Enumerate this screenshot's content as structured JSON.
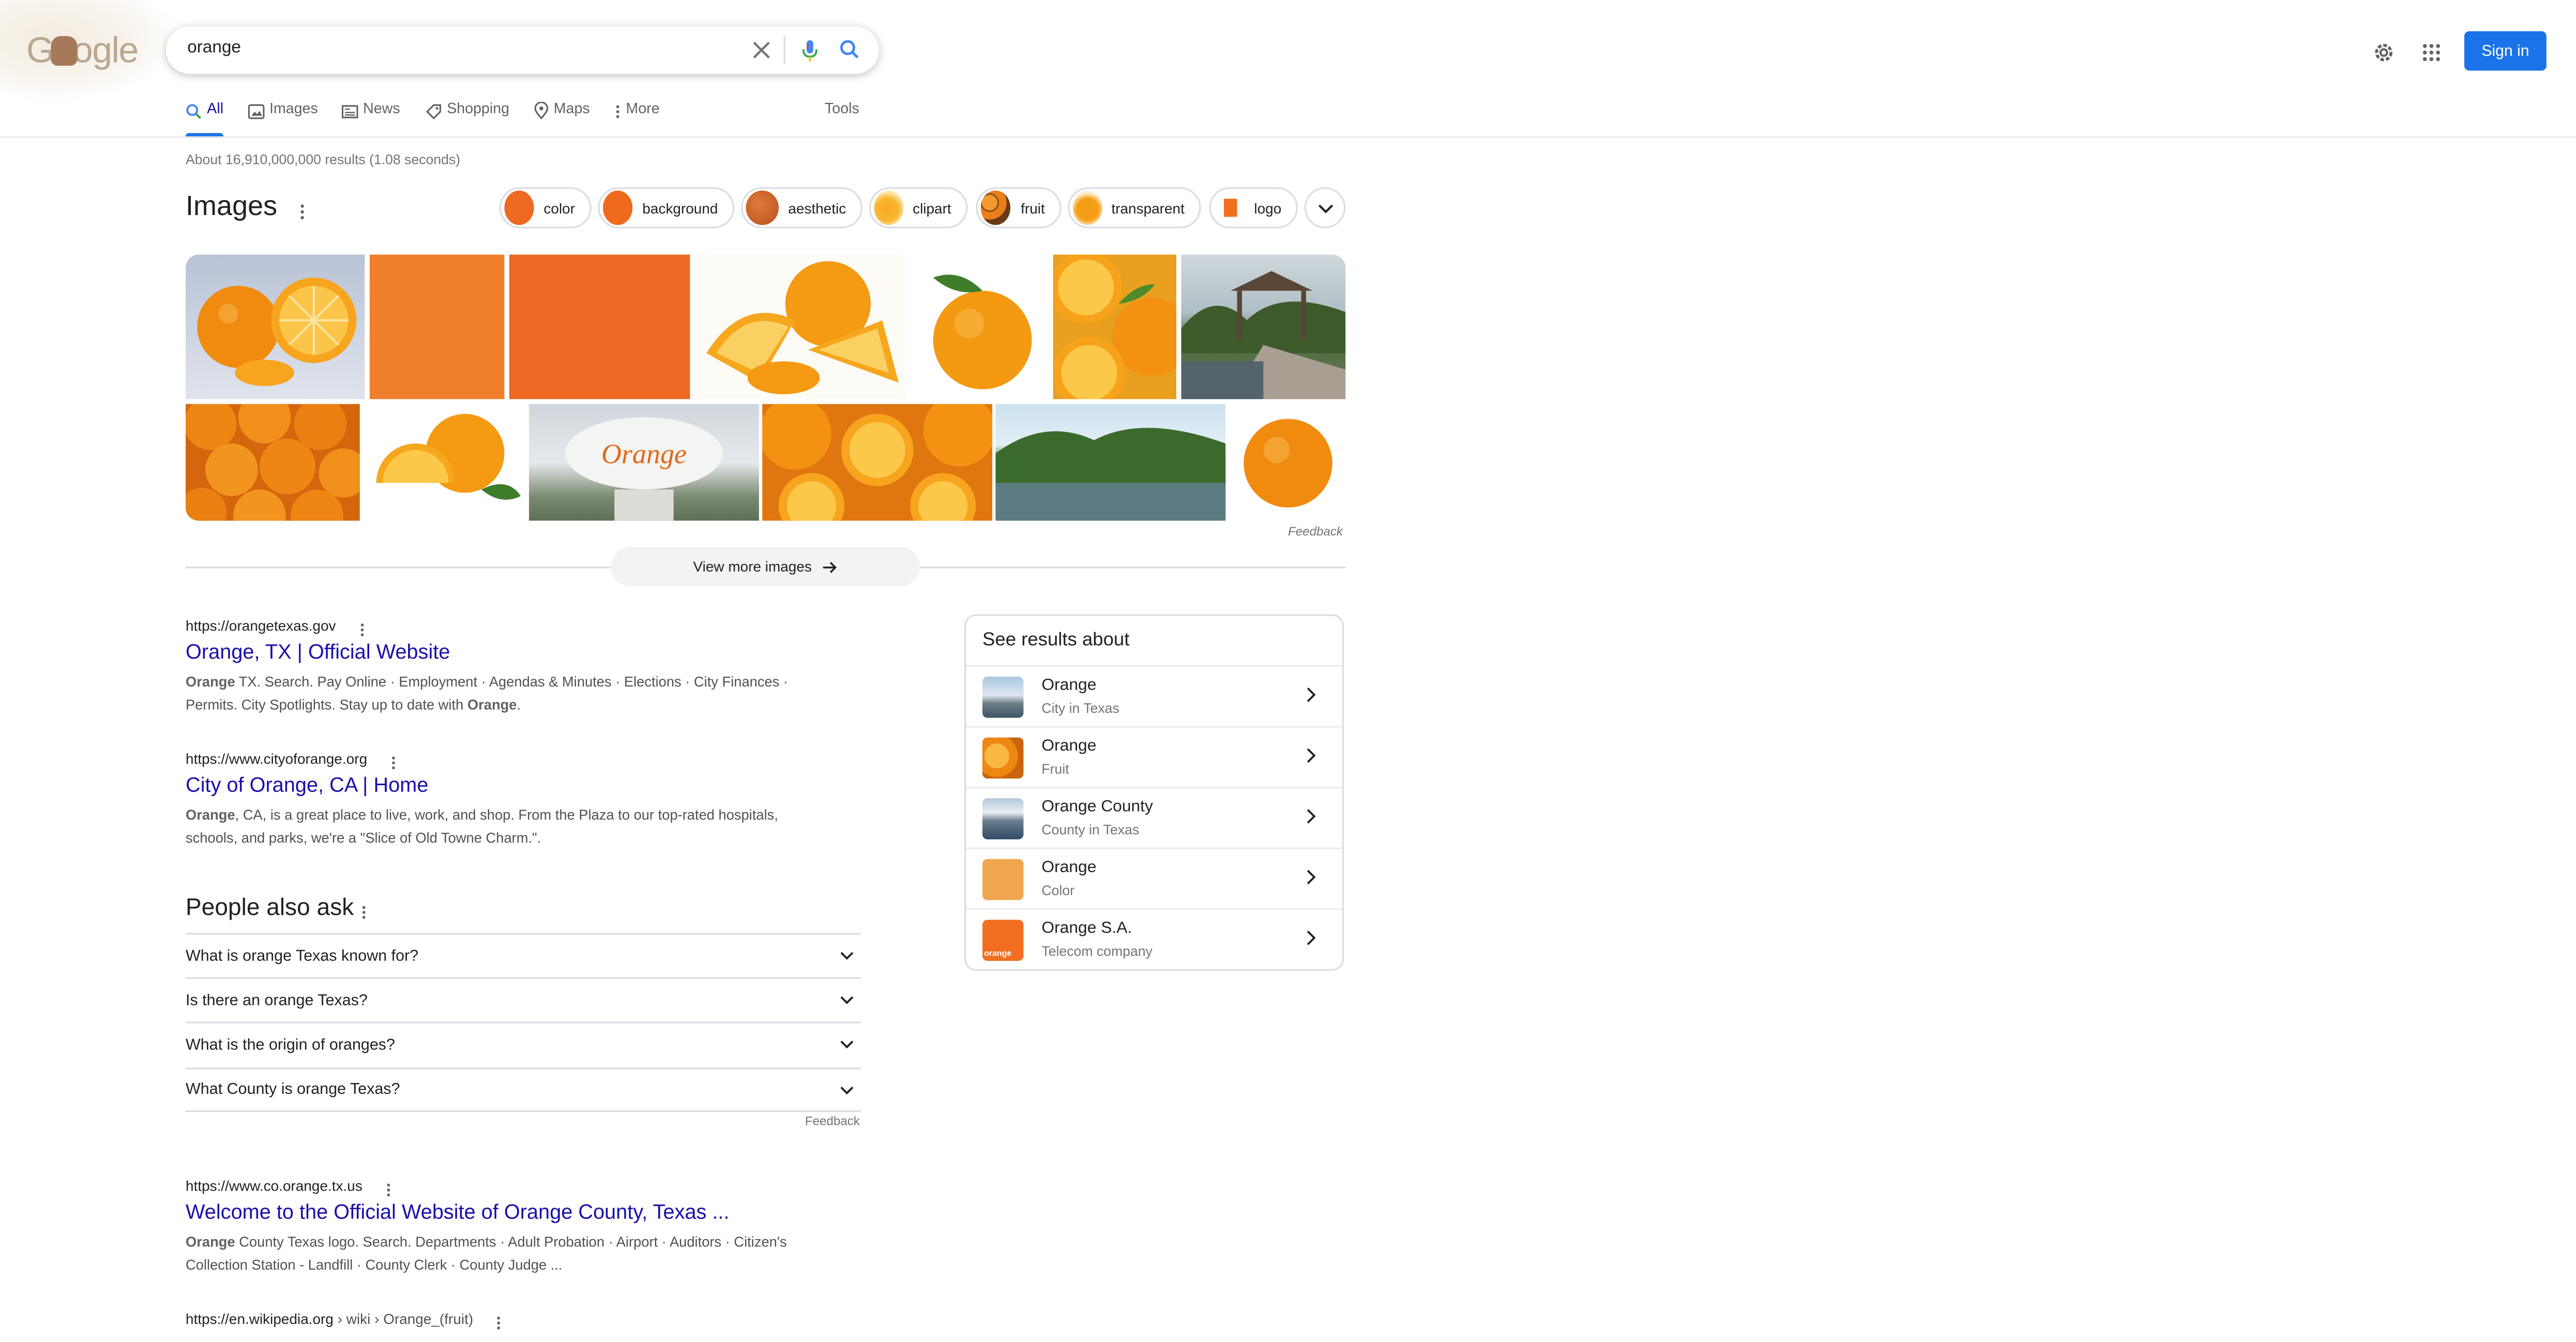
{
  "brand": {
    "logo_text": "Google",
    "accent": "#1a73e8",
    "link_color": "#1a0dab"
  },
  "search": {
    "query": "orange",
    "clear_icon": "close-icon",
    "mic_icon": "mic-icon",
    "search_icon": "search-icon"
  },
  "header": {
    "sign_in_label": "Sign in",
    "settings_icon": "gear-icon",
    "apps_icon": "apps-grid-icon"
  },
  "tabs": [
    {
      "label": "All",
      "icon": "search-icon",
      "active": true
    },
    {
      "label": "Images",
      "icon": "image-icon"
    },
    {
      "label": "News",
      "icon": "news-icon"
    },
    {
      "label": "Shopping",
      "icon": "tag-icon"
    },
    {
      "label": "Maps",
      "icon": "map-pin-icon"
    },
    {
      "label": "More",
      "icon": "more-vert-icon"
    }
  ],
  "tools_label": "Tools",
  "result_stats": "About 16,910,000,000 results (1.08 seconds)",
  "images_section": {
    "title": "Images",
    "chips": [
      "color",
      "background",
      "aesthetic",
      "clipart",
      "fruit",
      "transparent",
      "logo"
    ],
    "feedback": "Feedback",
    "view_more": "View more images"
  },
  "results": [
    {
      "url": "https://orangetexas.gov",
      "title": "Orange, TX | Official Website",
      "snippet_bold": "Orange",
      "snippet_line1": " TX. Search. Pay Online · Employment · Agendas & Minutes · Elections · City Finances ·",
      "snippet_line2": "Permits. City Spotlights. Stay up to date with ",
      "snippet_bold2": "Orange",
      "snippet_end": "."
    },
    {
      "url": "https://www.cityoforange.org",
      "title": "City of Orange, CA | Home",
      "snippet_bold": "Orange",
      "snippet_line1": ", CA, is a great place to live, work, and shop. From the Plaza to our top-rated hospitals,",
      "snippet_line2": "schools, and parks, we're a \"Slice of Old Towne Charm.\"."
    },
    {
      "url": "https://www.co.orange.tx.us",
      "title": "Welcome to the Official Website of Orange County, Texas ...",
      "snippet_bold": "Orange",
      "snippet_line1": " County Texas logo. Search. Departments · Adult Probation · Airport · Auditors · Citizen's",
      "snippet_line2": "Collection Station - Landfill · County Clerk · County Judge ..."
    },
    {
      "url": "https://en.wikipedia.org",
      "url_path": " › wiki › Orange_(fruit)"
    }
  ],
  "people_also_ask": {
    "title": "People also ask",
    "questions": [
      "What is orange Texas known for?",
      "Is there an orange Texas?",
      "What is the origin of oranges?",
      "What County is orange Texas?"
    ],
    "feedback": "Feedback"
  },
  "see_results_about": {
    "title": "See results about",
    "items": [
      {
        "name": "Orange",
        "sub": "City in Texas"
      },
      {
        "name": "Orange",
        "sub": "Fruit"
      },
      {
        "name": "Orange County",
        "sub": "County in Texas"
      },
      {
        "name": "Orange",
        "sub": "Color"
      },
      {
        "name": "Orange S.A.",
        "sub": "Telecom company",
        "logo_text": "orange"
      }
    ]
  }
}
